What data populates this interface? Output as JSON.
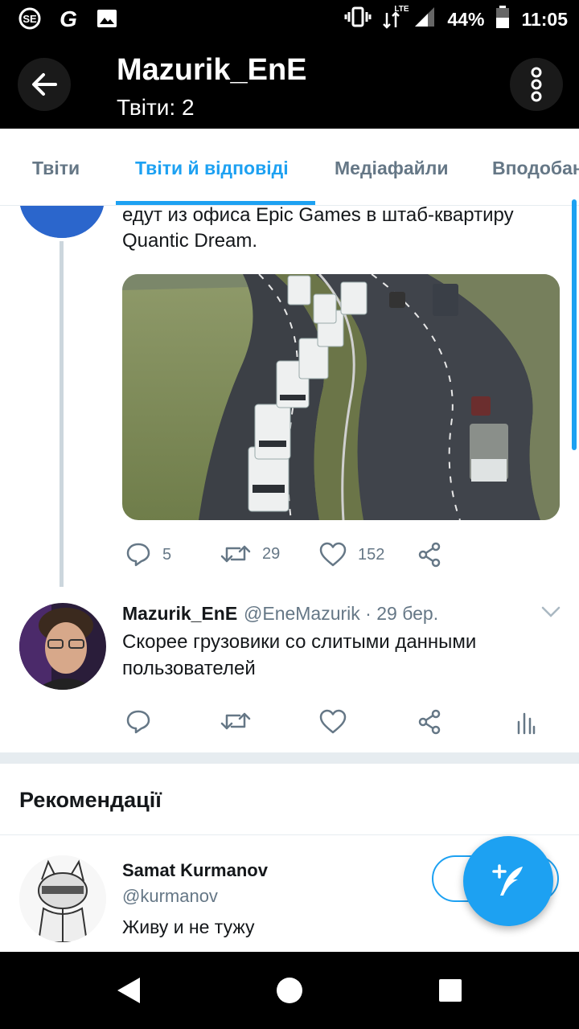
{
  "status_bar": {
    "battery": "44%",
    "time": "11:05",
    "network": "LTE",
    "icons": [
      "se-icon",
      "g-icon",
      "image-icon",
      "vibrate-icon",
      "network-icon",
      "signal-icon",
      "battery-icon"
    ]
  },
  "header": {
    "title": "Mazurik_EnE",
    "subtitle": "Твіти: 2"
  },
  "tabs": [
    {
      "label": "Твіти",
      "active": false
    },
    {
      "label": "Твіти й відповіді",
      "active": true
    },
    {
      "label": "Медіафайли",
      "active": false
    },
    {
      "label": "Вподобан",
      "active": false
    }
  ],
  "tweet1": {
    "text_line1": "едут из офиса Epic Games в штаб-квартиру",
    "text_line2": "Quantic Dream.",
    "reply_count": "5",
    "retweet_count": "29",
    "like_count": "152"
  },
  "tweet2": {
    "name": "Mazurik_EnE",
    "handle_date": "@EneMazurik · 29 бер.",
    "text_line1": "Скорее грузовики со слитыми данными",
    "text_line2": "пользователей"
  },
  "recommendations": {
    "header": "Рекомендації",
    "user": {
      "name": "Samat Kurmanov",
      "handle": "@kurmanov",
      "bio": "Живу и не тужу"
    }
  },
  "colors": {
    "accent": "#1da1f2",
    "secondary_text": "#657786",
    "primary_text": "#14171a"
  }
}
